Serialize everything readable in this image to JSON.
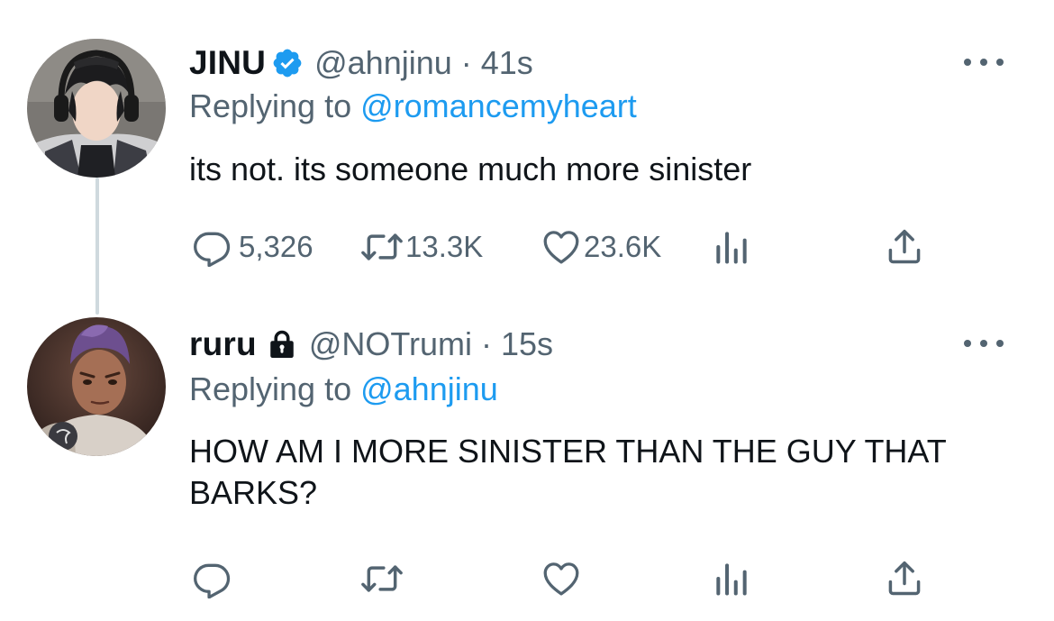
{
  "tweets": [
    {
      "name": "JINU",
      "handle": "@ahnjinu",
      "separator": "·",
      "time": "41s",
      "replying_prefix": "Replying to ",
      "replying_to": "@romancemyheart",
      "text": "its not. its someone much more sinister",
      "badge_icon": "verified-badge-icon",
      "actions": {
        "reply_count": "5,326",
        "retweet_count": "13.3K",
        "like_count": "23.6K"
      }
    },
    {
      "name": "ruru",
      "handle": "@NOTrumi",
      "separator": "·",
      "time": "15s",
      "replying_prefix": "Replying to ",
      "replying_to": "@ahnjinu",
      "text": "HOW AM I MORE SINISTER THAN THE GUY THAT BARKS?",
      "badge_icon": "lock-icon",
      "actions": {
        "reply_count": "",
        "retweet_count": "",
        "like_count": ""
      }
    }
  ],
  "colors": {
    "accent": "#1d9bf0",
    "secondary_text": "#536471",
    "primary_text": "#0f1419",
    "thread_line": "#cfd9de"
  }
}
